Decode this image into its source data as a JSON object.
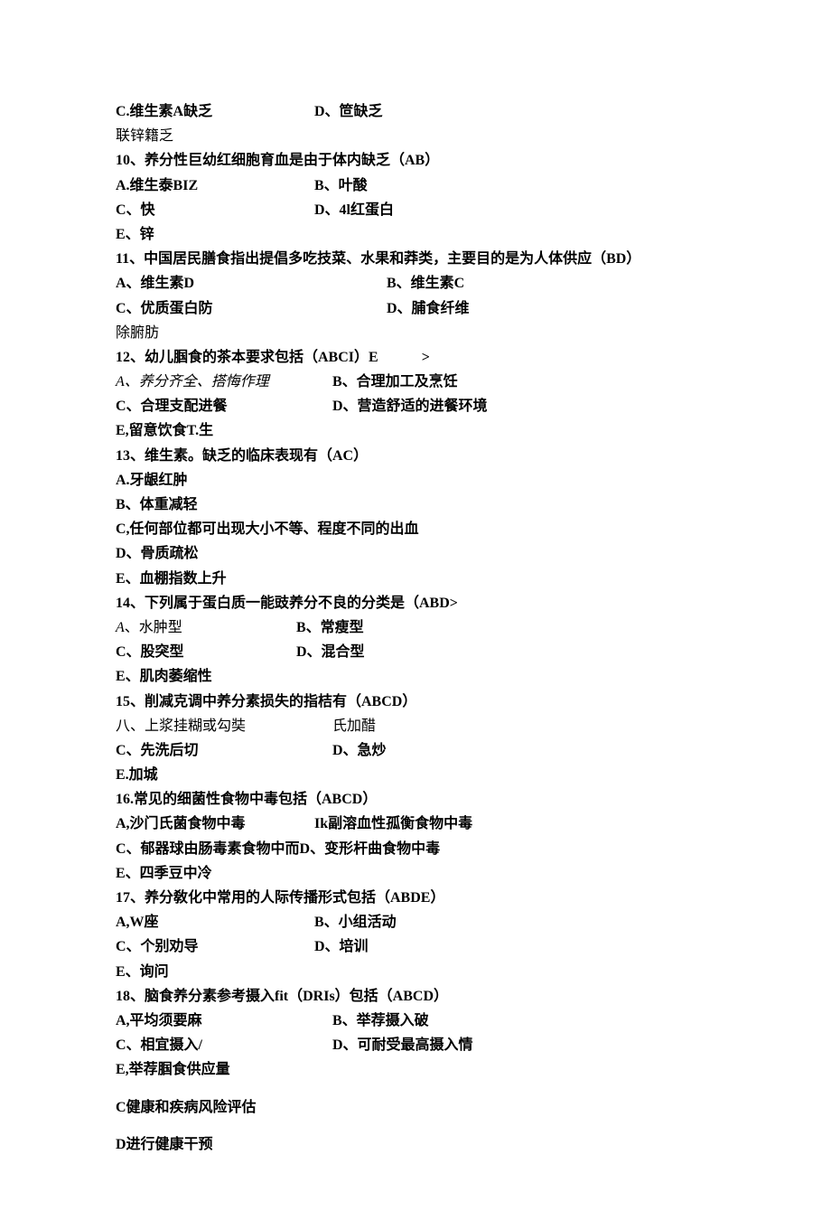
{
  "q9": {
    "optC": "C.维生素A缺乏",
    "optD": "D、笸缺乏",
    "extra": "联锌籍乏"
  },
  "q10": {
    "stem": "10、养分性巨幼红细胞育血是由于体内缺乏（AB）",
    "optA": "A.维生泰BIZ",
    "optB": "B、叶酸",
    "optC": "C、快",
    "optD": "D、4l红蛋白",
    "optE": "E、锌"
  },
  "q11": {
    "stem": "11、中国居民膳食指出提倡多吃技菜、水果和莽类，主要目的是为人体供应（BD）",
    "optA": "A、维生素D",
    "optB": "B、维生素C",
    "optC": "C、优质蛋白防",
    "optD": "D、脯食纤维",
    "extra": "除腑肪"
  },
  "q12": {
    "stem_pre": "12、幼儿腘食的茶本要求包括（ABCI）E",
    "stem_suf": ">",
    "optA": "A、养分齐全、搭悔作理",
    "optB": "B、合理加工及烹饪",
    "optC": "C、合理支配进餐",
    "optD": "D、营造舒适的进餐环境",
    "optE": "E,留意饮食T.生"
  },
  "q13": {
    "stem": "13、维生素。缺乏的临床表现有（AC）",
    "optA": "A.牙龈红肿",
    "optB": "B、体重减轻",
    "optC": "C,任何部位都可出现大小不等、程度不同的出血",
    "optD": "D、骨质疏松",
    "optE": "E、血棚指数上升"
  },
  "q14": {
    "stem": "14、下列属于蛋白质一能豉养分不良的分类是（ABD>",
    "optA": "A、水肿型",
    "optB": "B、常瘦型",
    "optC": "C、股突型",
    "optD": "D、混合型",
    "optE": "E、肌肉萎缩性"
  },
  "q15": {
    "stem": "15、削减克调中养分素损失的指桔有（ABCD）",
    "optA": "八、上浆挂糊或勾奘",
    "optB": "氏加醋",
    "optC": "C、先洗后切",
    "optD": "D、急炒",
    "optE": "E.加城"
  },
  "q16": {
    "stem": "16.常见的细菌性食物中毒包括（ABCD）",
    "optA": "A,沙门氏菌食物中毒",
    "optB": "Ik副溶血性孤衡食物中毒",
    "optC": "C、郁器球由肠毒素食物中而D、变形杆曲食物中毒",
    "optE": "E、四季豆中冷"
  },
  "q17": {
    "stem": "17、养分敎化中常用的人际传播形式包括（ABDE）",
    "optA": "A,W座",
    "optB": "B、小组活动",
    "optC": "C、个别劝导",
    "optD": "D、培训",
    "optE": "E、询问"
  },
  "q18": {
    "stem": "18、脑食养分素参考摄入fit（DRIs）包括（ABCD）",
    "optA": "A,平均须要麻",
    "optB": "B、举荐摄入破",
    "optC": "C、相宜摄入/",
    "optD": "D、可耐受最高摄入情",
    "optE": "E,举荐腘食供应量"
  },
  "tail": {
    "lineC": "C健康和疾病风险评估",
    "lineD": "D进行健康干预"
  }
}
